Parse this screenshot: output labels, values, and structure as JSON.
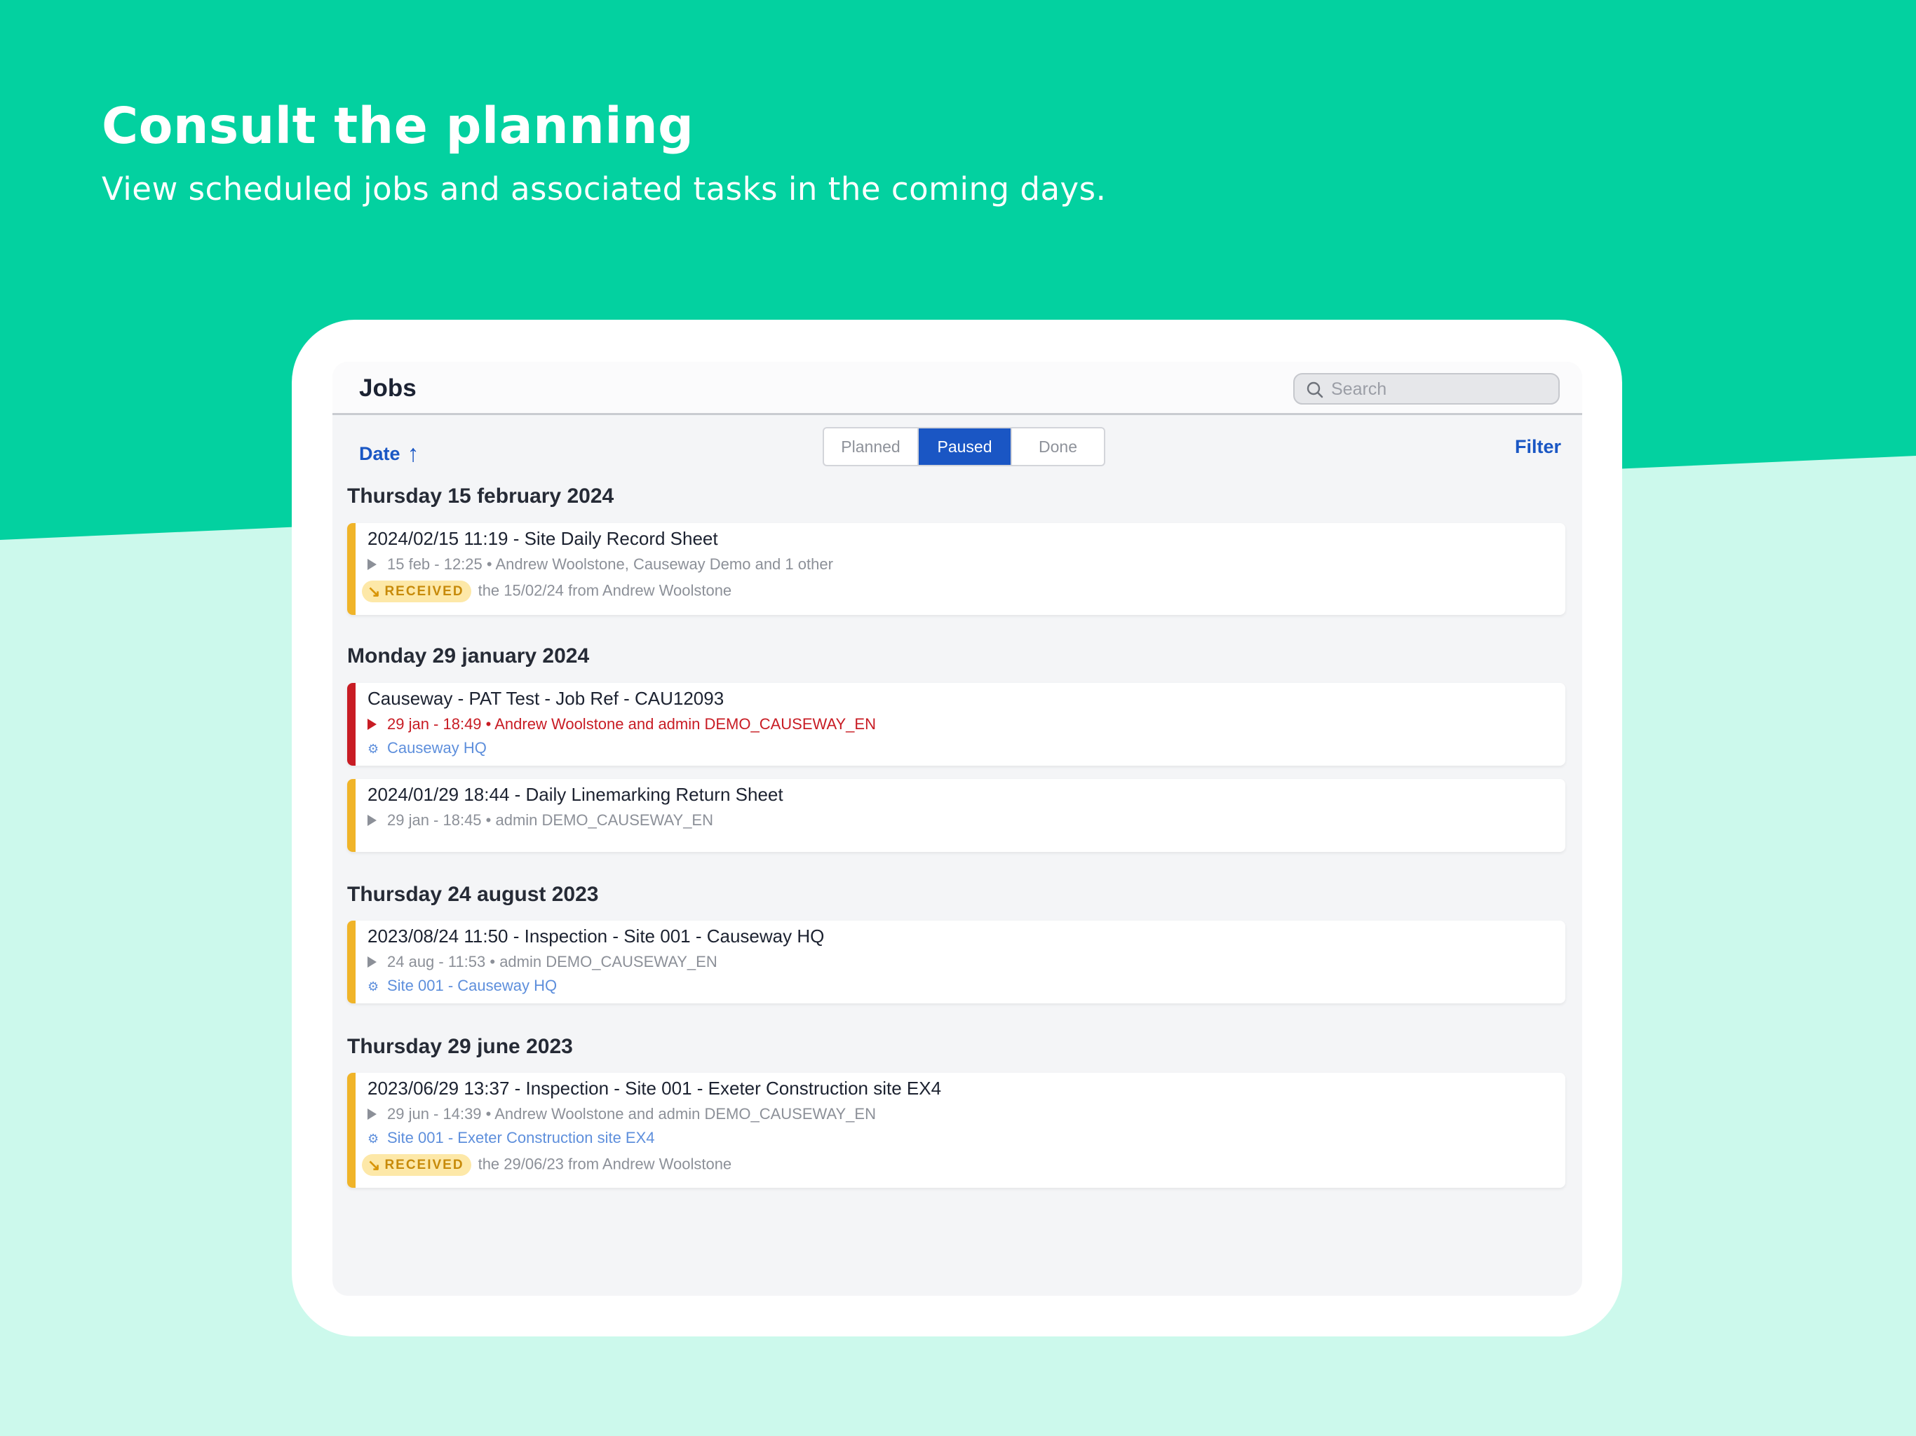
{
  "header": {
    "headline": "Consult the planning",
    "subline": "View scheduled jobs and associated tasks in the coming days."
  },
  "app": {
    "title": "Jobs",
    "search_placeholder": "Search",
    "sort_label": "Date",
    "sort_icon": "arrow-up-icon",
    "tabs": [
      {
        "label": "Planned",
        "active": false
      },
      {
        "label": "Paused",
        "active": true
      },
      {
        "label": "Done",
        "active": false
      }
    ],
    "filter_label": "Filter"
  },
  "colors": {
    "accent": "#1a56c4",
    "status_yellow": "#f0b429",
    "status_red": "#c81c24",
    "background_green": "#03d1a0",
    "background_mint": "#ccf9ec"
  },
  "groups": [
    {
      "date": "Thursday 15 february 2024",
      "jobs": [
        {
          "title": "2024/02/15 11:19 - Site Daily Record Sheet",
          "meta": "15 feb - 12:25 • Andrew Woolstone, Causeway Demo and 1 other",
          "received_badge": "RECEIVED",
          "received_text": "the 15/02/24 from Andrew Woolstone",
          "status_color": "#f0b429"
        }
      ]
    },
    {
      "date": "Monday 29 january 2024",
      "jobs": [
        {
          "title": "Causeway - PAT Test - Job Ref - CAU12093",
          "meta": "29 jan - 18:49 • Andrew Woolstone and admin DEMO_CAUSEWAY_EN",
          "site": "Causeway HQ",
          "status_color": "#c81c24"
        },
        {
          "title": "2024/01/29 18:44 - Daily Linemarking Return Sheet",
          "meta": "29 jan - 18:45 • admin DEMO_CAUSEWAY_EN",
          "status_color": "#f0b429"
        }
      ]
    },
    {
      "date": "Thursday 24 august 2023",
      "jobs": [
        {
          "title": "2023/08/24 11:50 - Inspection - Site 001 - Causeway HQ",
          "meta": "24 aug - 11:53 • admin DEMO_CAUSEWAY_EN",
          "site": "Site 001 - Causeway HQ",
          "status_color": "#f0b429"
        }
      ]
    },
    {
      "date": "Thursday 29 june 2023",
      "jobs": [
        {
          "title": "2023/06/29 13:37 - Inspection - Site 001 - Exeter Construction site EX4",
          "meta": "29 jun - 14:39 • Andrew Woolstone and admin DEMO_CAUSEWAY_EN",
          "site": "Site 001 - Exeter Construction site EX4",
          "received_badge": "RECEIVED",
          "received_text": "the 29/06/23 from Andrew Woolstone",
          "status_color": "#f0b429"
        }
      ]
    }
  ]
}
